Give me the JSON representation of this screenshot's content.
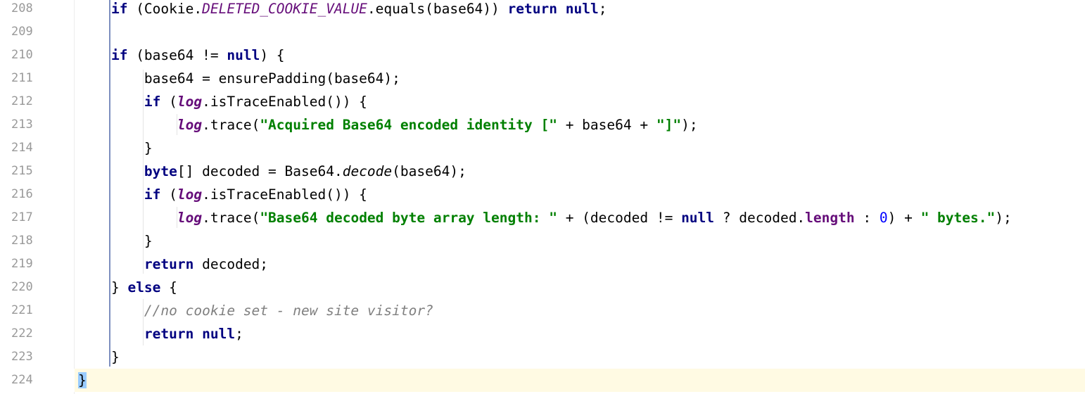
{
  "editor": {
    "current_line": "224",
    "lines": [
      {
        "num": "208",
        "segments": [
          {
            "t": "    "
          },
          {
            "t": "if",
            "c": "kw"
          },
          {
            "t": " (Cookie."
          },
          {
            "t": "DELETED_COOKIE_VALUE",
            "c": "sfld"
          },
          {
            "t": ".equals(base64)) "
          },
          {
            "t": "return",
            "c": "kw"
          },
          {
            "t": " "
          },
          {
            "t": "null",
            "c": "kw"
          },
          {
            "t": ";"
          }
        ]
      },
      {
        "num": "209",
        "segments": []
      },
      {
        "num": "210",
        "segments": [
          {
            "t": "    "
          },
          {
            "t": "if",
            "c": "kw"
          },
          {
            "t": " (base64 != "
          },
          {
            "t": "null",
            "c": "kw"
          },
          {
            "t": ") {"
          }
        ]
      },
      {
        "num": "211",
        "segments": [
          {
            "t": "        base64 = ensurePadding(base64);"
          }
        ]
      },
      {
        "num": "212",
        "segments": [
          {
            "t": "        "
          },
          {
            "t": "if",
            "c": "kw"
          },
          {
            "t": " ("
          },
          {
            "t": "log",
            "c": "fld"
          },
          {
            "t": ".isTraceEnabled()) {"
          }
        ]
      },
      {
        "num": "213",
        "segments": [
          {
            "t": "            "
          },
          {
            "t": "log",
            "c": "fld"
          },
          {
            "t": ".trace("
          },
          {
            "t": "\"Acquired Base64 encoded identity [\"",
            "c": "str"
          },
          {
            "t": " + base64 + "
          },
          {
            "t": "\"]\"",
            "c": "str"
          },
          {
            "t": ");"
          }
        ]
      },
      {
        "num": "214",
        "segments": [
          {
            "t": "        }"
          }
        ]
      },
      {
        "num": "215",
        "segments": [
          {
            "t": "        "
          },
          {
            "t": "byte",
            "c": "kw"
          },
          {
            "t": "[] decoded = Base64."
          },
          {
            "t": "decode",
            "c": "mi"
          },
          {
            "t": "(base64);"
          }
        ]
      },
      {
        "num": "216",
        "segments": [
          {
            "t": "        "
          },
          {
            "t": "if",
            "c": "kw"
          },
          {
            "t": " ("
          },
          {
            "t": "log",
            "c": "fld"
          },
          {
            "t": ".isTraceEnabled()) {"
          }
        ]
      },
      {
        "num": "217",
        "segments": [
          {
            "t": "            "
          },
          {
            "t": "log",
            "c": "fld"
          },
          {
            "t": ".trace("
          },
          {
            "t": "\"Base64 decoded byte array length: \"",
            "c": "str"
          },
          {
            "t": " + (decoded != "
          },
          {
            "t": "null",
            "c": "kw"
          },
          {
            "t": " ? decoded."
          },
          {
            "t": "length",
            "c": "ifld"
          },
          {
            "t": " : "
          },
          {
            "t": "0",
            "c": "num"
          },
          {
            "t": ") + "
          },
          {
            "t": "\" bytes.\"",
            "c": "str"
          },
          {
            "t": ");"
          }
        ]
      },
      {
        "num": "218",
        "segments": [
          {
            "t": "        }"
          }
        ]
      },
      {
        "num": "219",
        "segments": [
          {
            "t": "        "
          },
          {
            "t": "return",
            "c": "kw"
          },
          {
            "t": " decoded;"
          }
        ]
      },
      {
        "num": "220",
        "segments": [
          {
            "t": "    } "
          },
          {
            "t": "else",
            "c": "kw"
          },
          {
            "t": " {"
          }
        ]
      },
      {
        "num": "221",
        "segments": [
          {
            "t": "        "
          },
          {
            "t": "//no cookie set - new site visitor?",
            "c": "cmt"
          }
        ]
      },
      {
        "num": "222",
        "segments": [
          {
            "t": "        "
          },
          {
            "t": "return",
            "c": "kw"
          },
          {
            "t": " "
          },
          {
            "t": "null",
            "c": "kw"
          },
          {
            "t": ";"
          }
        ]
      },
      {
        "num": "223",
        "segments": [
          {
            "t": "    }"
          }
        ]
      },
      {
        "num": "224",
        "segments": [
          {
            "t": "}",
            "c": "bm"
          }
        ]
      }
    ]
  }
}
